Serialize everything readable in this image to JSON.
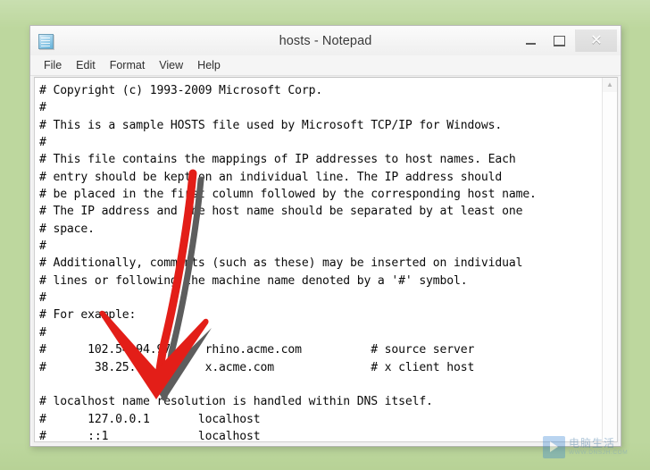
{
  "desktop": {
    "background_color": "#bdd79e"
  },
  "window": {
    "title": "hosts - Notepad",
    "app_icon": "notepad-document-icon",
    "controls": {
      "minimize_label": "–",
      "maximize_label": "❑",
      "close_label": "✕"
    },
    "menu": [
      {
        "label": "File"
      },
      {
        "label": "Edit"
      },
      {
        "label": "Format"
      },
      {
        "label": "View"
      },
      {
        "label": "Help"
      }
    ],
    "scrollbar": {
      "up_arrow": "▲",
      "down_arrow": "▼"
    }
  },
  "editor": {
    "lines": [
      {
        "text": "# Copyright (c) 1993-2009 Microsoft Corp.",
        "selected": false
      },
      {
        "text": "#",
        "selected": false
      },
      {
        "text": "# This is a sample HOSTS file used by Microsoft TCP/IP for Windows.",
        "selected": false
      },
      {
        "text": "#",
        "selected": false
      },
      {
        "text": "# This file contains the mappings of IP addresses to host names. Each",
        "selected": false
      },
      {
        "text": "# entry should be kept on an individual line. The IP address should",
        "selected": false
      },
      {
        "text": "# be placed in the first column followed by the corresponding host name.",
        "selected": false
      },
      {
        "text": "# The IP address and the host name should be separated by at least one",
        "selected": false
      },
      {
        "text": "# space.",
        "selected": false
      },
      {
        "text": "#",
        "selected": false
      },
      {
        "text": "# Additionally, comments (such as these) may be inserted on individual",
        "selected": false
      },
      {
        "text": "# lines or following the machine name denoted by a '#' symbol.",
        "selected": false
      },
      {
        "text": "#",
        "selected": false
      },
      {
        "text": "# For example:",
        "selected": false
      },
      {
        "text": "#",
        "selected": false
      },
      {
        "text": "#      102.54.94.97     rhino.acme.com          # source server",
        "selected": false
      },
      {
        "text": "#       38.25.63.10     x.acme.com              # x client host",
        "selected": false
      },
      {
        "text": "",
        "selected": false
      },
      {
        "text": "# localhost name resolution is handled within DNS itself.",
        "selected": false
      },
      {
        "text": "#\t127.0.0.1       localhost",
        "selected": true
      },
      {
        "text": "#\t::1             localhost",
        "selected": true
      }
    ],
    "selection_color": "#1b8ae5",
    "selection_text_color": "#ffffff"
  },
  "annotation": {
    "type": "hand-drawn-down-arrow",
    "color": "#e31e18",
    "shadow_color": "#5d5d5d",
    "points_at": "highlighted localhost lines"
  },
  "watermark": {
    "cn_text": "电脑生活",
    "en_text": "WWW.DNSJH.COM"
  }
}
